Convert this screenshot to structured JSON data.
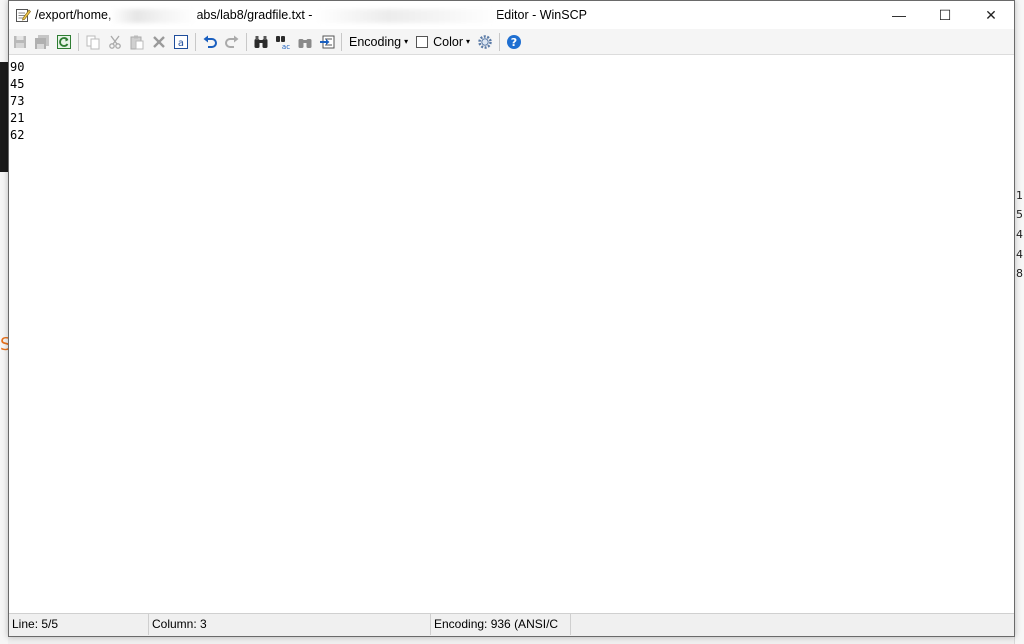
{
  "window": {
    "title_prefix": "/export/home,",
    "title_mid": "abs/lab8/gradfile.txt - ",
    "title_suffix": "Editor - WinSCP",
    "minimize_glyph": "—",
    "maximize_glyph": "☐",
    "close_glyph": "✕"
  },
  "toolbar": {
    "encoding_label": "Encoding",
    "color_label": "Color",
    "dropdown_arrow": "▾"
  },
  "editor": {
    "lines": [
      "90",
      "45",
      "73",
      "21",
      "62"
    ]
  },
  "statusbar": {
    "line": "Line: 5/5",
    "column": "Column: 3",
    "encoding": "Encoding: 936   (ANSI/C"
  },
  "background": {
    "left_orange_text": "S",
    "right_digits": [
      "1",
      "5",
      "4",
      "4",
      "8"
    ]
  }
}
